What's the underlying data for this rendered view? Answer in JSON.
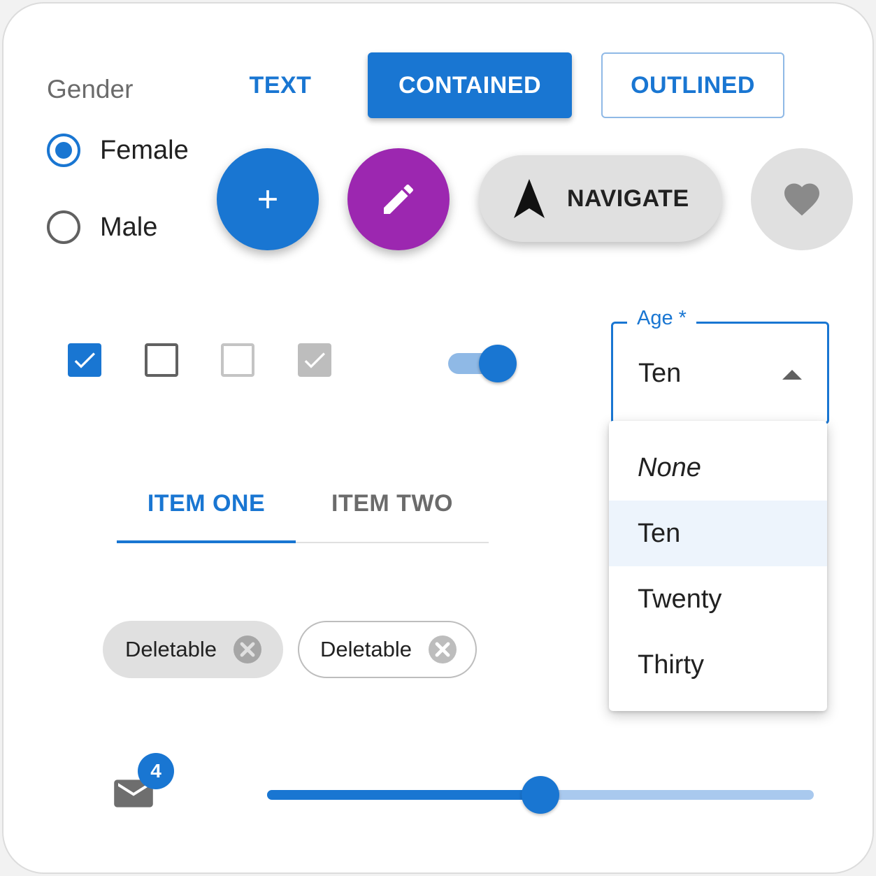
{
  "radio_group": {
    "label": "Gender",
    "options": [
      {
        "label": "Female",
        "checked": true
      },
      {
        "label": "Male",
        "checked": false
      }
    ]
  },
  "buttons": {
    "text": "TEXT",
    "contained": "CONTAINED",
    "outlined": "OUTLINED"
  },
  "fabs": {
    "add_icon": "add-icon",
    "edit_icon": "edit-icon",
    "navigate_label": "NAVIGATE",
    "navigate_icon": "navigation-icon",
    "like_icon": "favorite-icon"
  },
  "checkboxes": [
    {
      "checked": true,
      "disabled": false
    },
    {
      "checked": false,
      "disabled": false
    },
    {
      "checked": false,
      "disabled": true
    },
    {
      "checked": true,
      "disabled": true
    }
  ],
  "switch": {
    "on": true
  },
  "select": {
    "label": "Age *",
    "value": "Ten",
    "options": [
      "None",
      "Ten",
      "Twenty",
      "Thirty"
    ],
    "selected_index": 1
  },
  "tabs": {
    "items": [
      "ITEM ONE",
      "ITEM TWO"
    ],
    "active_index": 0
  },
  "chips": [
    {
      "label": "Deletable",
      "variant": "filled"
    },
    {
      "label": "Deletable",
      "variant": "outlined"
    }
  ],
  "badge": {
    "count": "4",
    "icon": "mail-icon"
  },
  "slider": {
    "value": 0.5
  },
  "colors": {
    "primary": "#1976d2",
    "secondary": "#9c27b0",
    "default_fab": "#e0e0e0"
  }
}
